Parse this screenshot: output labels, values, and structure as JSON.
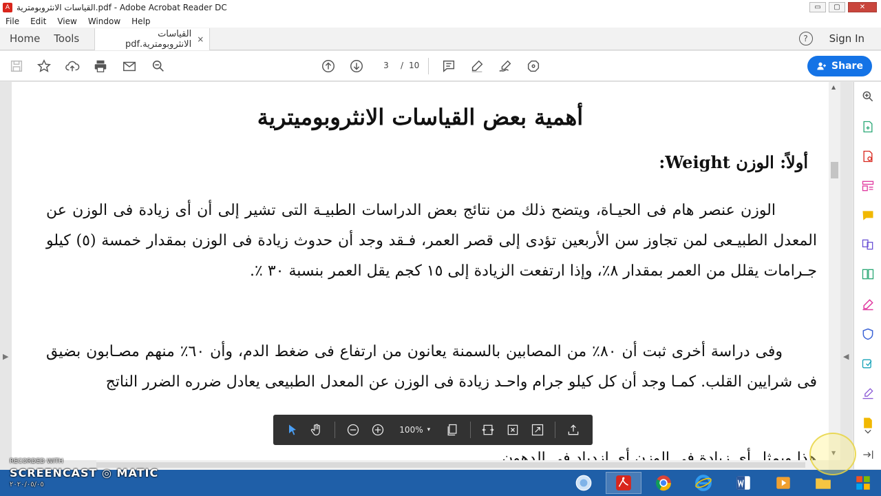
{
  "window": {
    "title": "القياسات الانثروبومترية.pdf - Adobe Acrobat Reader DC",
    "controls": {
      "minimize": "▭",
      "maximize": "▢",
      "close": "✕"
    }
  },
  "menu": [
    "File",
    "Edit",
    "View",
    "Window",
    "Help"
  ],
  "tabs": {
    "home": "Home",
    "tools": "Tools",
    "document": "القياسات الانثروبومترية.pdf",
    "close": "×"
  },
  "header": {
    "help": "?",
    "sign_in": "Sign In"
  },
  "toolbar": {
    "page_current": "3",
    "page_separator": "/",
    "page_total": "10",
    "share_label": "Share"
  },
  "document": {
    "heading": "أهمية بعض القياسات الانثروبوميترية",
    "section_title": "أولاً: الوزن Weight:",
    "paragraphs": [
      "الوزن عنصر هام فى الحيـاة، ويتضح ذلك من نتائج بعض الدراسات الطبيـة التى تشير إلى أن أى زيادة فى الوزن عن المعدل الطبيـعى لمن تجاوز سن الأربعين تؤدى إلى قصر العمر، فـقد وجد أن حدوث زيادة فى الوزن بمقدار خمسة (٥) كيلو جـرامات يقلل من العمر بمقدار ٨٪، وإذا ارتفعت الزيادة إلى ١٥ كجم يقل العمر بنسبة ٣٠ ٪.",
      "وفى دراسة أخرى ثبت أن ٨٠٪ من المصابين بالسمنة يعانون من ارتفاع فى ضغط الدم، وأن ٦٠٪ منهم مصـابون بضيق فى شرايين القلب. كمـا وجد أن كل كيلو جرام واحـد زيادة فى الوزن عن المعدل الطبيعى يعادل ضرره الضرر الناتج",
      "هذا ويمثل أى زيادة فى الوزن أى ازدياد فى الدهون"
    ]
  },
  "floating_toolbar": {
    "zoom": "100%",
    "caret": "▾"
  },
  "watermark": {
    "recorded": "RECORDED WITH",
    "brand": "SCREENCAST",
    "brand_suffix": "MATIC",
    "date": "٢٠٢٠/٠٥/٠٥"
  },
  "colors": {
    "accent": "#1473e6",
    "taskbar": "#1f5fa8",
    "pdf_red": "#d9261c",
    "float_bar": "#323232"
  }
}
